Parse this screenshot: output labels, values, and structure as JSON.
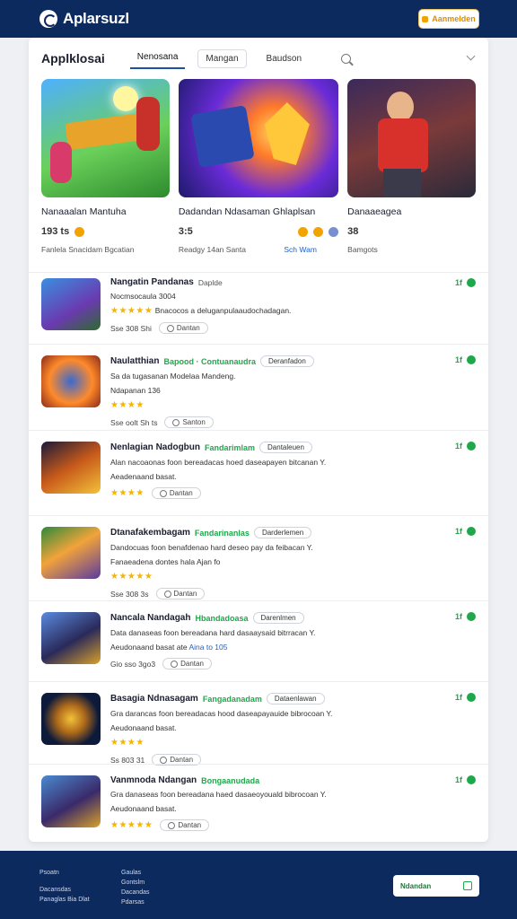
{
  "header": {
    "brand": "Aplarsuzl",
    "button_label": "Aanmelden"
  },
  "tabs_bar": {
    "title": "Applklosai",
    "tabs": [
      "Nenosana",
      "Mangan",
      "Baudson"
    ]
  },
  "featured": [
    {
      "name": "Nanaaalan Mantuha",
      "stat": "193 ts",
      "category": "Fanlela Snacidam Bgcatian",
      "category_highlight": ""
    },
    {
      "name": "Dadandan Ndasaman Ghlaplsan",
      "stat": "3:5",
      "category": "Readgy 14an Santa",
      "category_highlight": "Sch Wam"
    },
    {
      "name": "Danaaeagea",
      "stat": "38",
      "category": "Bamgots",
      "category_highlight": ""
    }
  ],
  "list": [
    {
      "title": "Nangatin Pandanas",
      "tag": "Daplde",
      "meta": "Nocmsocaula 3004",
      "desc": "Bnacocos a deluganpulaaudochadagan.",
      "rating": "4.5",
      "stats": "Sse 308 Shi",
      "action": "Dantan",
      "side": "1f"
    },
    {
      "title": "Naulatthian",
      "green": "Bapood · Contuanaudra",
      "pill": "Deranfadon",
      "desc": "Sa da tugasanan Modelaa Mandeng.",
      "desc2": "Ndapanan 136",
      "rating": "4.0",
      "stats": "Sse oolt Sh ts",
      "action": "Santon",
      "side": "1f"
    },
    {
      "title": "Nenlagian Nadogbun",
      "green": "Fandarimlam",
      "pill": "Dantaleuen",
      "desc": "Alan nacoaonas foon bereadacas hoed daseapayen bitcanan Y.",
      "desc2": "Aeadenaand basat.",
      "rating": "4.0",
      "stats": "",
      "action": "Dantan",
      "side": "1f"
    },
    {
      "title": "Dtanafakembagam",
      "green": "Fandarinanlas",
      "pill": "Darderlemen",
      "desc": "Dandocuas foon benafdenao hard deseo pay da feibacan Y.",
      "desc2": "Fanaeadena dontes hala Ajan fo",
      "desc_hl": "Ajan fo",
      "rating": "4.5",
      "stats": "Sse 308 3s",
      "action": "Dantan",
      "side": "1f"
    },
    {
      "title": "Nancala Nandagah",
      "green": "Hbandadoasa",
      "pill": "Darenlmen",
      "desc": "Data danaseas foon bereadana hard dasaaysaid bitrracan Y.",
      "desc2": "Aeudonaand basat ate",
      "desc_hl": "Aina to 105",
      "rating": "",
      "stats": "Gio sso 3go3",
      "action": "Dantan",
      "side": "1f"
    },
    {
      "title": "Basagia Ndnasagam",
      "green": "Fangadanadam",
      "pill": "Dataenlawan",
      "desc": "Gra darancas foon bereadacas hood daseapayauide bibrocoan Y.",
      "desc2": "Aeudonaand basat.",
      "rating": "4.5",
      "stats": "Ss 803 31",
      "action": "Dantan",
      "side": "1f"
    },
    {
      "title": "Vanmnoda Ndangan",
      "green": "Bongaanudada",
      "pill": "",
      "desc": "Gra danaseas foon bereadana haed dasaeoyouald bibrocoan Y.",
      "desc2": "Aeudonaand basat.",
      "rating": "4.5",
      "stats": "",
      "action": "Dantan",
      "side": "1f"
    }
  ],
  "footer": {
    "col1": [
      "Psoatn",
      "",
      "Dacansdas",
      "Panaglas Bia Dlat"
    ],
    "col2": [
      "Gaulas",
      "Gontslm",
      "Dacandas",
      "Pdarsas"
    ],
    "button_label": "Ndandan"
  },
  "colors": {
    "brand": "#0d2a5e",
    "accent_green": "#1fa84a",
    "accent_orange": "#f2a300",
    "link_blue": "#1c60c8"
  }
}
